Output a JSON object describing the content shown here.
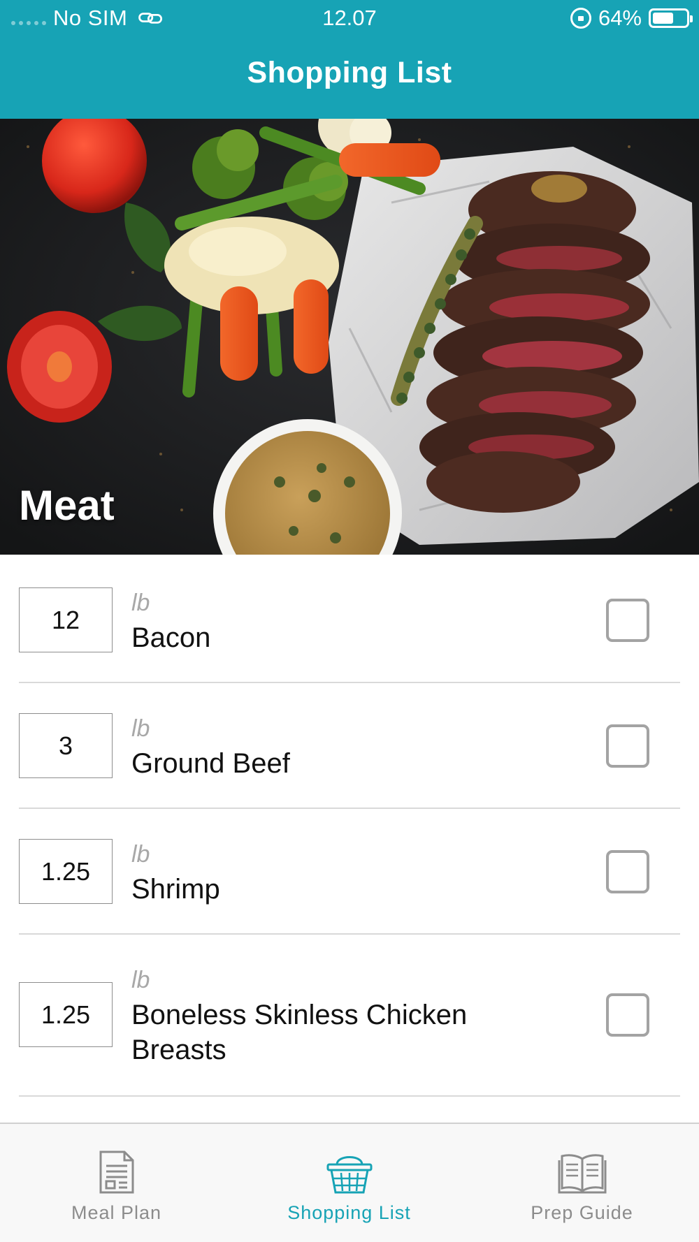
{
  "status_bar": {
    "carrier": "No SIM",
    "time": "12.07",
    "battery": "64%",
    "battery_level": 0.64
  },
  "nav": {
    "title": "Shopping List"
  },
  "category": {
    "label": "Meat"
  },
  "items": [
    {
      "quantity": "12",
      "unit": "lb",
      "name": "Bacon",
      "checked": false
    },
    {
      "quantity": "3",
      "unit": "lb",
      "name": "Ground Beef",
      "checked": false
    },
    {
      "quantity": "1.25",
      "unit": "lb",
      "name": "Shrimp",
      "checked": false
    },
    {
      "quantity": "1.25",
      "unit": "lb",
      "name": "Boneless Skinless Chicken Breasts",
      "checked": false
    }
  ],
  "tabs": [
    {
      "label": "Meal Plan",
      "icon": "document-icon",
      "active": false
    },
    {
      "label": "Shopping List",
      "icon": "basket-icon",
      "active": true
    },
    {
      "label": "Prep Guide",
      "icon": "open-book-icon",
      "active": false
    }
  ],
  "colors": {
    "accent": "#17a3b5",
    "tab_inactive": "#8c8c8c",
    "checkbox_border": "#a3a3a3"
  }
}
